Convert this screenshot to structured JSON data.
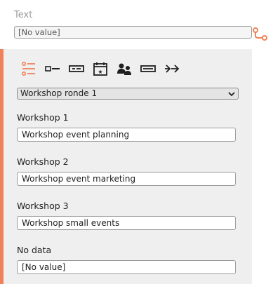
{
  "top": {
    "label": "Text",
    "value": "[No value]"
  },
  "colors": {
    "accent": "#f08158",
    "panel": "#efefef",
    "icon_dark": "#1f1f1f"
  },
  "toolbar": {
    "icons": [
      "list-icon",
      "text-field-icon",
      "input-box-icon",
      "calendar-icon",
      "users-icon",
      "field-icon",
      "arrows-icon"
    ]
  },
  "selector": {
    "selected": "Workshop ronde 1"
  },
  "fields": [
    {
      "label": "Workshop 1",
      "value": "Workshop event planning"
    },
    {
      "label": "Workshop 2",
      "value": "Workshop event marketing"
    },
    {
      "label": "Workshop 3",
      "value": "Workshop small events"
    },
    {
      "label": "No data",
      "value": "[No value]"
    }
  ]
}
